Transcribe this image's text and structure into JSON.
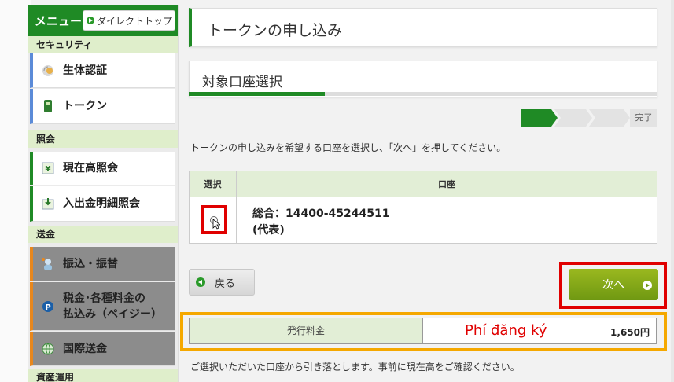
{
  "sidebar": {
    "menu_title": "メニュー",
    "direct_top_label": "ダイレクトトップ",
    "categories": {
      "security": "セキュリティ",
      "inquiry": "照会",
      "transfer": "送金",
      "asset": "資産運用"
    },
    "items": [
      {
        "label": "生体認証"
      },
      {
        "label": "トークン"
      },
      {
        "label": "現在高照会"
      },
      {
        "label": "入出金明細照会"
      },
      {
        "label": "振込・振替"
      },
      {
        "label_line1": "税金･各種料金の",
        "label_line2": "払込み（ペイジー）"
      },
      {
        "label": "国際送金"
      }
    ]
  },
  "main": {
    "page_title": "トークンの申し込み",
    "step_title": "対象口座選択",
    "step_progress": 0.29,
    "steps_done_label": "完了",
    "instruction": "トークンの申し込みを希望する口座を選択し、「次へ」を押してください。",
    "table": {
      "header_select": "選択",
      "header_account": "口座",
      "row": {
        "account_number": "総合：14400-45244511",
        "owner": "(代表)"
      }
    },
    "back_label": "戻る",
    "next_label": "次へ",
    "fee": {
      "label": "発行料金",
      "annotation": "Phí đăng ký",
      "value": "1,650円"
    },
    "footer_note": "ご選択いただいた口座から引き落とします。事前に現在高をご確認ください。"
  },
  "colors": {
    "brand_green": "#1f8a25",
    "next_green": "#7fa417",
    "highlight_red": "#e00000",
    "highlight_orange": "#f5a800"
  }
}
